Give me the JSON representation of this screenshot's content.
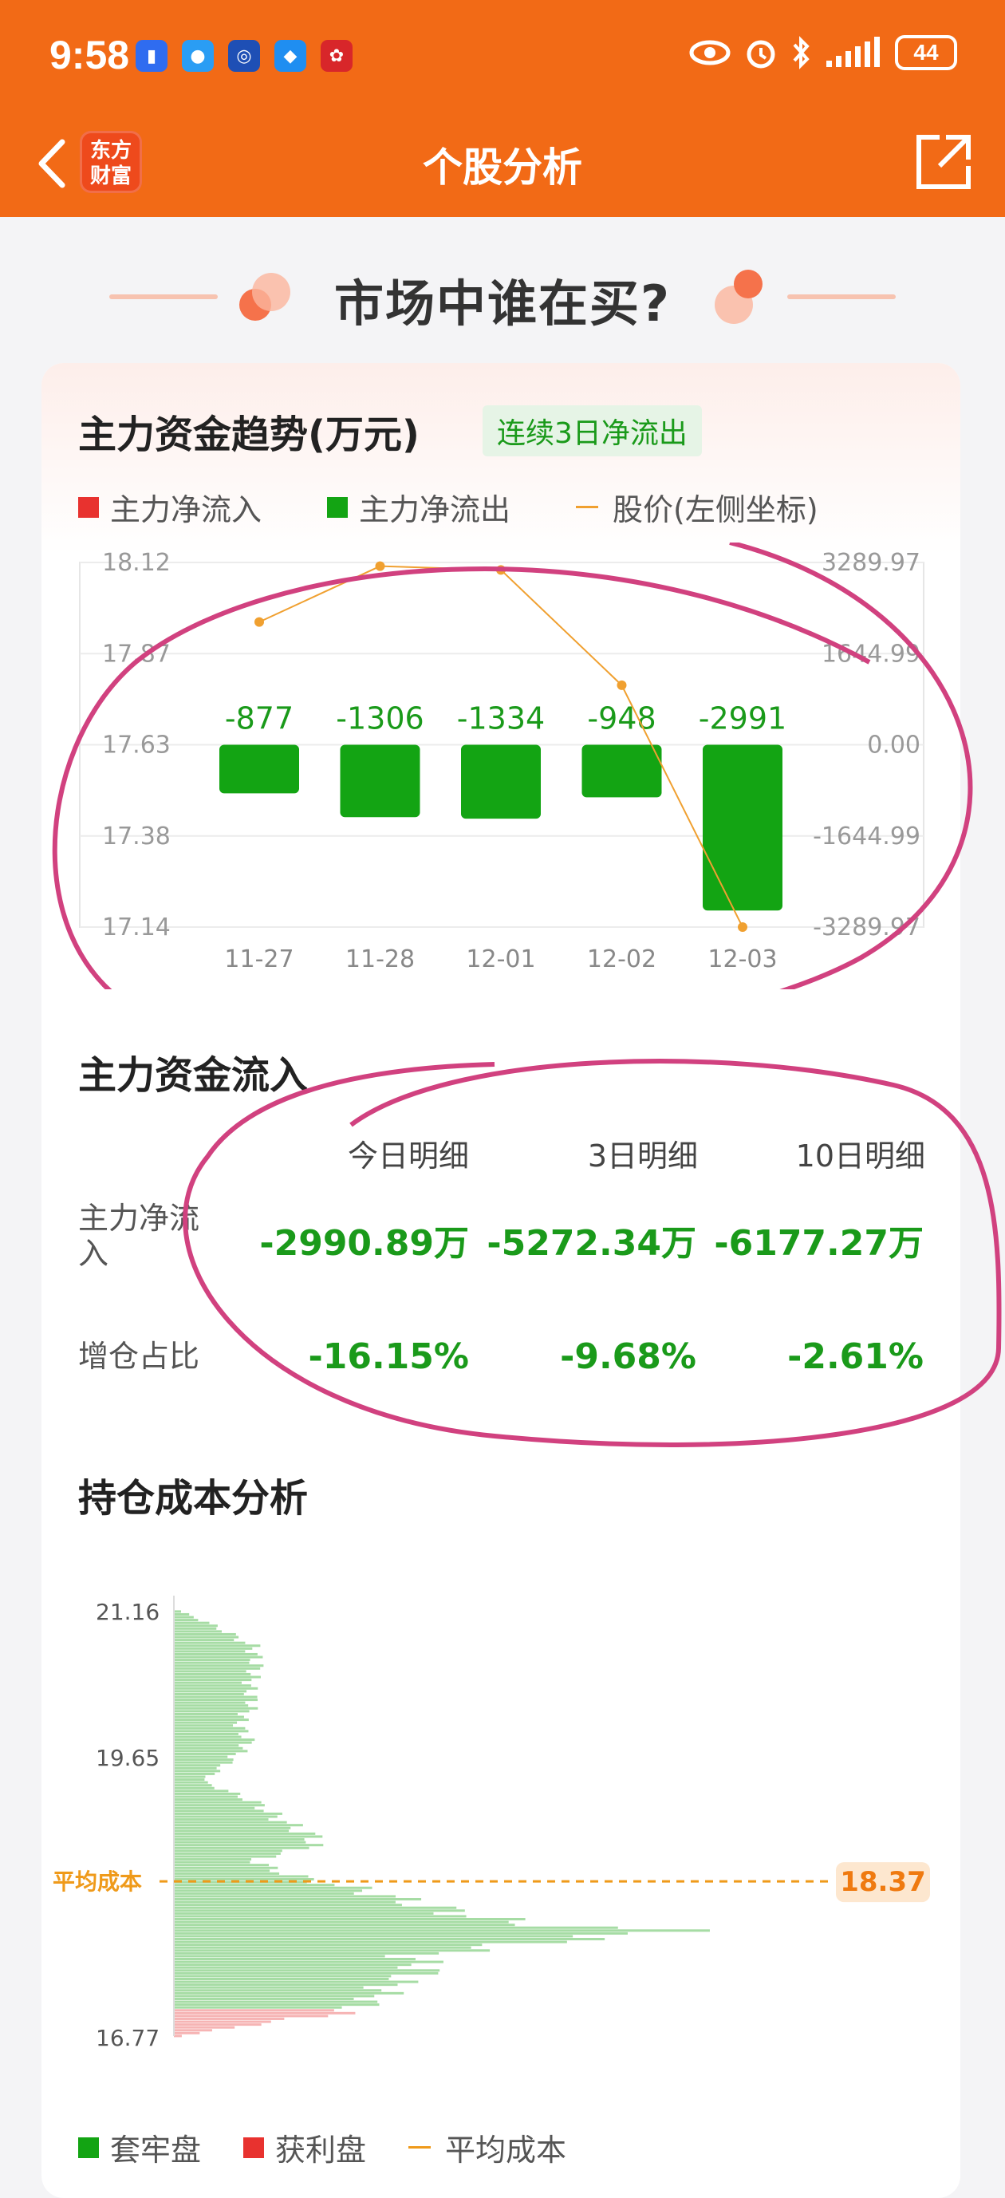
{
  "status_bar": {
    "time": "9:58",
    "battery": "44"
  },
  "nav": {
    "title": "个股分析",
    "logo_line1": "东方",
    "logo_line2": "财富"
  },
  "banner": {
    "title": "市场中谁在买?"
  },
  "main_flow_trend": {
    "title": "主力资金趋势(万元)",
    "tag": "连续3日净流出",
    "legend": {
      "inflow": "主力净流入",
      "outflow": "主力净流出",
      "price": "股价(左侧坐标)"
    }
  },
  "chart_data": [
    {
      "type": "bar",
      "title": "",
      "categories": [
        "11-27",
        "11-28",
        "12-01",
        "12-02",
        "12-03"
      ],
      "series": [
        {
          "name": "主力净流出",
          "values": [
            -877,
            -1306,
            -1334,
            -948,
            -2991
          ]
        },
        {
          "name": "股价(左侧坐标)",
          "values": [
            17.96,
            18.11,
            18.1,
            17.79,
            17.14
          ]
        }
      ],
      "value_labels": [
        "-877",
        "-1306",
        "-1334",
        "-948",
        "-2991"
      ],
      "left_ticks": [
        "18.12",
        "17.87",
        "17.63",
        "17.38",
        "17.14"
      ],
      "right_ticks": [
        "3289.97",
        "1644.99",
        "0.00",
        "-1644.99",
        "-3289.97"
      ],
      "ylim_left": [
        17.14,
        18.12
      ],
      "ylim_right": [
        -3289.97,
        3289.97
      ],
      "colors": {
        "outflow": "#13a413",
        "inflow": "#e8322f",
        "price": "#f0a030"
      }
    },
    {
      "type": "bar",
      "title": "",
      "orientation": "horizontal",
      "y_ticks": [
        "21.16",
        "19.65",
        "16.77"
      ],
      "ylim": [
        16.77,
        21.16
      ],
      "average_cost": 18.37,
      "average_cost_label": "平均成本",
      "average_cost_value": "18.37",
      "legend": [
        "套牢盘",
        "获利盘",
        "平均成本"
      ],
      "colors": {
        "trapped": "#a6dca4",
        "profit": "#f6b4b4",
        "avg": "#ef9a1a"
      }
    }
  ],
  "flow_in": {
    "title": "主力资金流入",
    "headers": [
      "今日明细",
      "3日明细",
      "10日明细"
    ],
    "rows": [
      {
        "label": "主力净流入",
        "values": [
          "-2990.89万",
          "-5272.34万",
          "-6177.27万"
        ]
      },
      {
        "label": "增仓占比",
        "values": [
          "-16.15%",
          "-9.68%",
          "-2.61%"
        ]
      }
    ]
  },
  "cost_analysis": {
    "title": "持仓成本分析"
  }
}
